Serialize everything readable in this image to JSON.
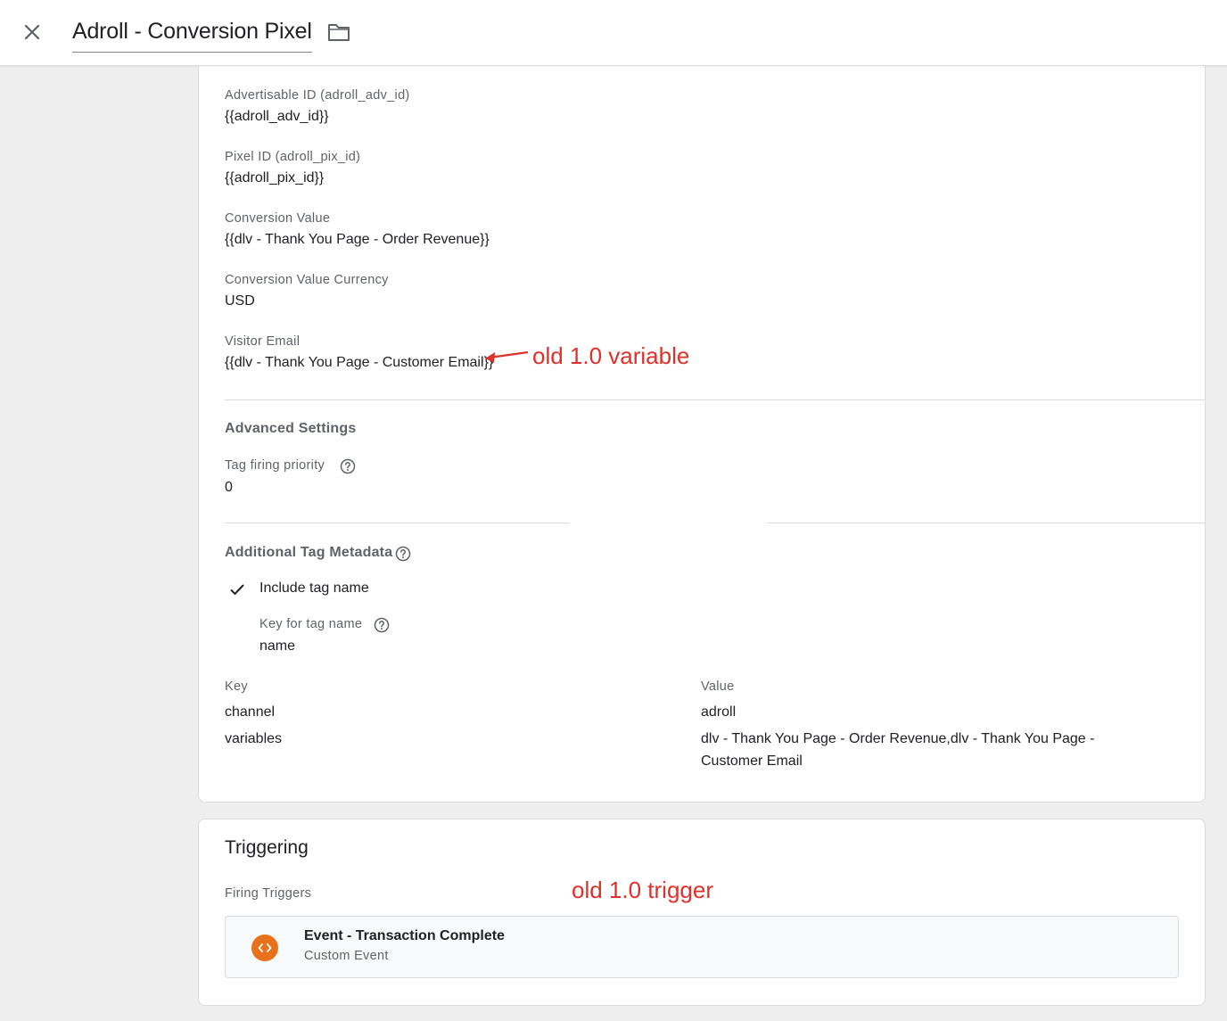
{
  "header": {
    "title": "Adroll - Conversion Pixel"
  },
  "tag_config": {
    "fields": [
      {
        "label": "Advertisable ID (adroll_adv_id)",
        "value": "{{adroll_adv_id}}"
      },
      {
        "label": "Pixel ID (adroll_pix_id)",
        "value": "{{adroll_pix_id}}"
      },
      {
        "label": "Conversion Value",
        "value": "{{dlv - Thank You Page - Order Revenue}}"
      },
      {
        "label": "Conversion Value Currency",
        "value": "USD"
      },
      {
        "label": "Visitor Email",
        "value": "{{dlv - Thank You Page - Customer Email}}"
      }
    ],
    "variable_annotation": "old 1.0 variable"
  },
  "advanced_settings": {
    "title": "Advanced Settings",
    "priority_label": "Tag firing priority",
    "priority_value": "0"
  },
  "metadata": {
    "title": "Additional Tag Metadata",
    "include_tag_name_label": "Include tag name",
    "include_tag_name_checked": true,
    "key_for_tag_name_label": "Key for tag name",
    "key_for_tag_name_value": "name",
    "table": {
      "headers": [
        "Key",
        "Value"
      ],
      "rows": [
        {
          "key": "channel",
          "value": "adroll"
        },
        {
          "key": "variables",
          "value_line1": "dlv - Thank You Page - Order Revenue,dlv - Thank You Page -",
          "value_line2": "Customer Email"
        }
      ]
    }
  },
  "triggering": {
    "title": "Triggering",
    "firing_label": "Firing Triggers",
    "trigger_annotation": "old 1.0 trigger",
    "trigger": {
      "name": "Event - Transaction Complete",
      "type": "Custom Event",
      "icon": "custom-event-icon",
      "icon_color": "#e8711c"
    }
  },
  "colors": {
    "annotation": "#e0302a",
    "background": "#eeeeee"
  }
}
